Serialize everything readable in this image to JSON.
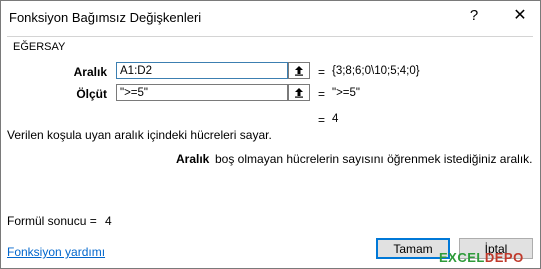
{
  "window": {
    "title": "Fonksiyon Bağımsız Değişkenleri",
    "help": "?",
    "close": "✕"
  },
  "group": {
    "title": "EĞERSAY"
  },
  "args": [
    {
      "label": "Aralık",
      "value": "A1:D2",
      "eq": "=",
      "result": "{3;8;6;0\\10;5;4;0}"
    },
    {
      "label": "Ölçüt",
      "value": "\">=5\"",
      "eq": "=",
      "result": "\">=5\""
    }
  ],
  "function_result": {
    "eq": "=",
    "value": "4"
  },
  "description": "Verilen koşula uyan aralık içindeki hücreleri sayar.",
  "arg_help": {
    "name": "Aralık",
    "text": "boş olmayan hücrelerin sayısını öğrenmek istediğiniz aralık."
  },
  "formula_result": {
    "label": "Formül sonucu =",
    "value": "4"
  },
  "help_link": "Fonksiyon yardımı",
  "buttons": {
    "ok": "Tamam",
    "cancel": "İptal"
  },
  "watermark": {
    "part1": "EXCEL",
    "part2": "DEPO",
    "color1": "#2e9b3a",
    "color2": "#c0392b"
  }
}
